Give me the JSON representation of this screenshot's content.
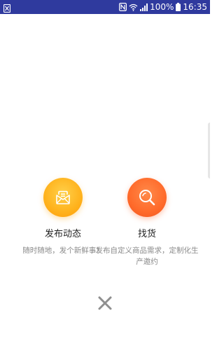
{
  "status_bar": {
    "battery_text": "100%",
    "time": "16:35",
    "icons": [
      "app-notification-icon",
      "nfc-icon",
      "wifi-icon",
      "signal-icon",
      "battery-icon"
    ],
    "background": "#2f3a9e"
  },
  "actions": [
    {
      "title": "发布动态",
      "description": "随时随地，发个新鲜事！",
      "icon": "envelope-icon",
      "color": "#ffb21c"
    },
    {
      "title": "找货",
      "description": "发布自定义商品需求，定制化生产邀约",
      "icon": "magnifier-icon",
      "color": "#ff6a2a"
    }
  ],
  "close": {
    "icon": "close-icon"
  }
}
